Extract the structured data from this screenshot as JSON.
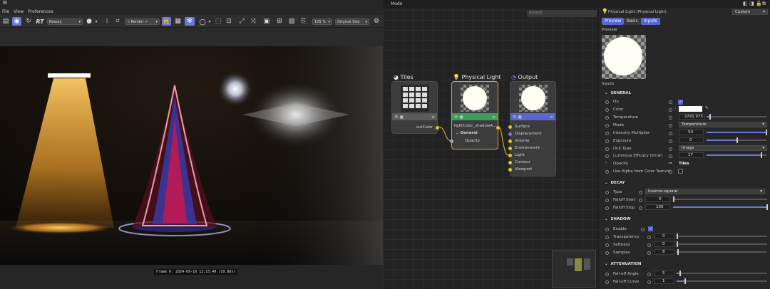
{
  "menu": {
    "file": "File",
    "view": "View",
    "preferences": "Preferences"
  },
  "toolbar": {
    "rt_label": "RT",
    "channel": "Beauty",
    "render_mode": "< Render >",
    "zoom": "105 %",
    "size": "Original Size"
  },
  "status": {
    "frame_info": "Frame 0: 2024-09-18 12:15:40 (10.86s)"
  },
  "node_editor": {
    "mode_label": "Mode",
    "search_placeholder": "Attrezd",
    "tiles": {
      "title": "Tiles",
      "out_port": "outColor"
    },
    "light": {
      "title": "Physical Light",
      "input_port": "lightColor_shadowA...",
      "group": "General",
      "opacity": "Opacity"
    },
    "output": {
      "title": "Output",
      "ports": [
        "Surface",
        "Displacement",
        "Volume",
        "Environment",
        "Light",
        "Contour",
        "Viewport"
      ]
    }
  },
  "attributes": {
    "title": "Physical Light (Physical Light)",
    "preset": "Custom",
    "tabs": [
      "Preview",
      "Basic",
      "Inputs"
    ],
    "preview_label": "Preview",
    "inputs_label": "Inputs",
    "general": {
      "header": "GENERAL",
      "on": "On",
      "color": "Color",
      "temperature": "Temperature",
      "temperature_value": "2291.975",
      "mode": "Mode",
      "mode_value": "Temperature",
      "intensity": "Intensity Multiplier",
      "intensity_value": "50",
      "exposure": "Exposure",
      "exposure_value": "0",
      "unit_type": "Unit Type",
      "unit_type_value": "Image",
      "efficacy": "Luminous Efficacy (lm/w)",
      "efficacy_value": "17",
      "opacity": "Opacity",
      "opacity_value": "Tiles",
      "use_alpha": "Use Alpha from Color Texture"
    },
    "decay": {
      "header": "DECAY",
      "type": "Type",
      "type_value": "Inverse-square",
      "falloff_start": "Falloff Start",
      "falloff_start_value": "0",
      "falloff_stop": "Falloff Stop",
      "falloff_stop_value": "100"
    },
    "shadow": {
      "header": "SHADOW",
      "enable": "Enable",
      "transparency": "Transparency",
      "transparency_value": "0",
      "softness": "Softness",
      "softness_value": "0",
      "samples": "Samples",
      "samples_value": "8"
    },
    "attenuation": {
      "header": "ATTENUATION",
      "falloff_angle": "Fall-off Angle",
      "falloff_angle_value": "5",
      "falloff_curve": "Fall-off Curve",
      "falloff_curve_value": "1"
    }
  },
  "colors": {
    "accent": "#6b78d8",
    "tiles_header": "#5a5a5a",
    "light_header": "#3a9c5a",
    "output_header": "#5865d0",
    "port": "#e3c232"
  },
  "icons": [
    "menu-icon",
    "clapper-icon",
    "render-icon",
    "refresh-icon",
    "crop-icon",
    "lock-icon",
    "grid-icon",
    "snowflake-icon",
    "circle-icon",
    "settings-icon"
  ],
  "progress": {
    "intensity": 0.99,
    "exposure": 0.5,
    "efficacy": 0.9,
    "falloff_stop": 1.0,
    "samples": 0.01,
    "transparency": 0.0,
    "softness": 0.0,
    "falloff_angle": 0.03,
    "falloff_curve": 0.09,
    "temperature": 0.05
  }
}
